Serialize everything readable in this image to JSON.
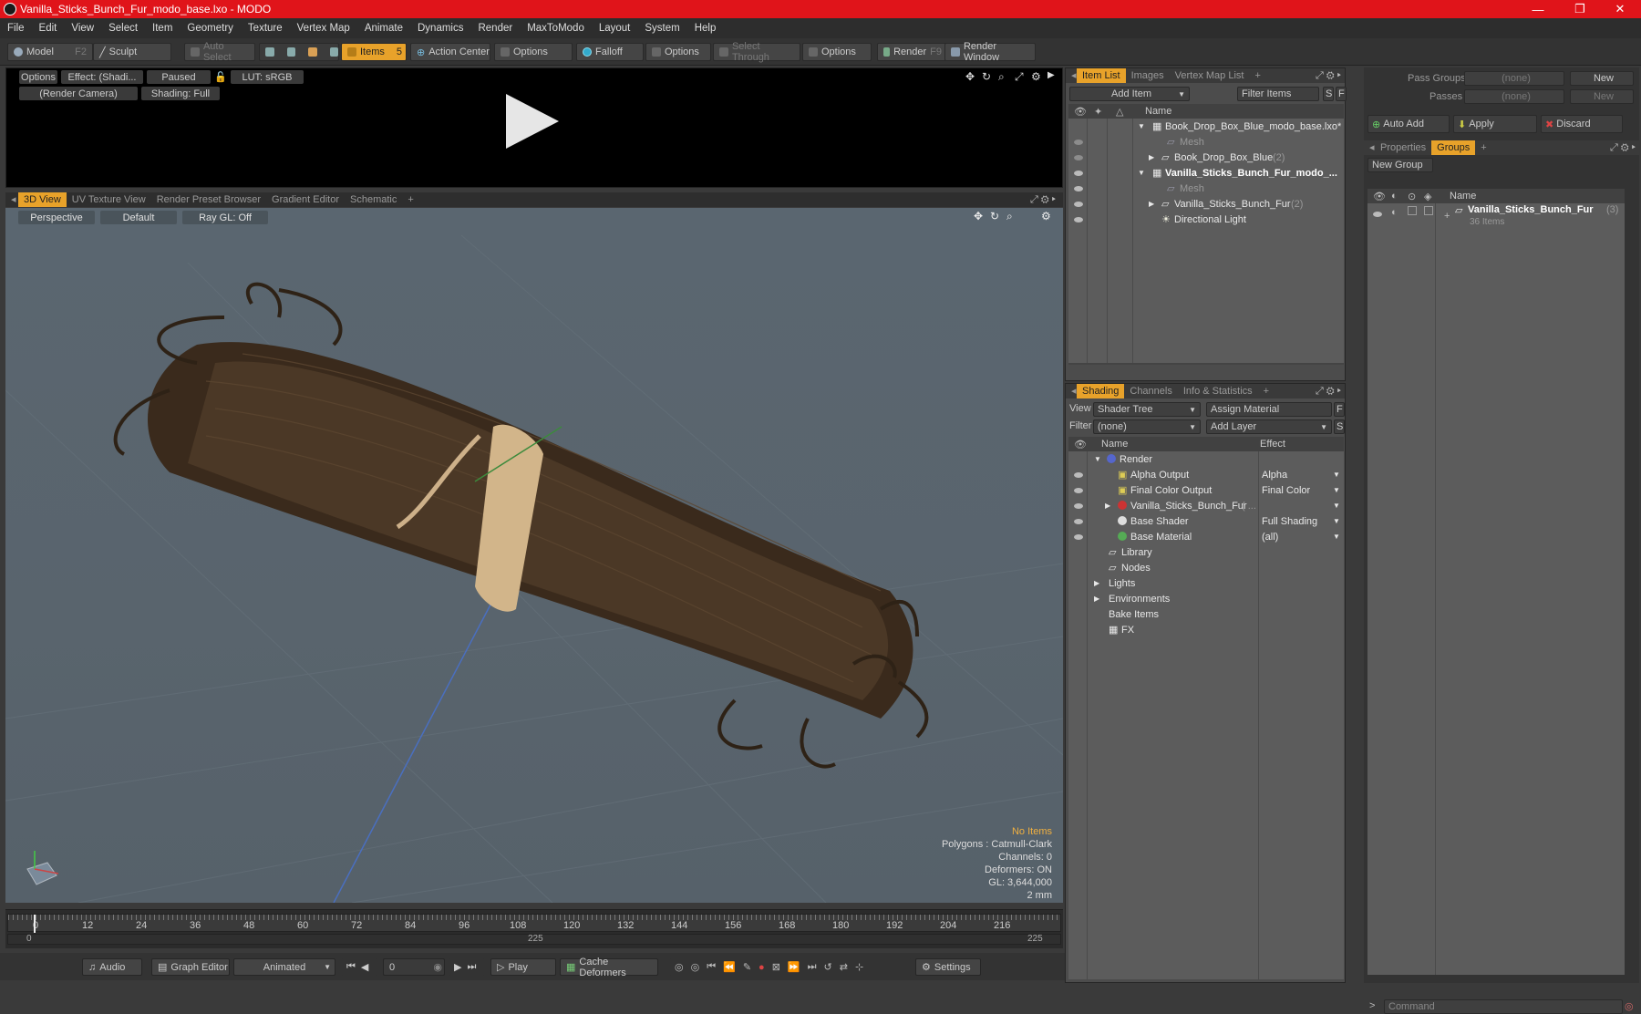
{
  "title": "Vanilla_Sticks_Bunch_Fur_modo_base.lxo - MODO",
  "window_controls": [
    "—",
    "❐",
    "✕"
  ],
  "menu": [
    "File",
    "Edit",
    "View",
    "Select",
    "Item",
    "Geometry",
    "Texture",
    "Vertex Map",
    "Animate",
    "Dynamics",
    "Render",
    "MaxToModo",
    "Layout",
    "System",
    "Help"
  ],
  "toolbar": {
    "model": "Model",
    "model_key": "F2",
    "sculpt": "Sculpt",
    "auto_select": "Auto Select",
    "items": "Items",
    "items_key": "5",
    "action_center": "Action Center",
    "options1": "Options",
    "falloff": "Falloff",
    "options2": "Options",
    "select_through": "Select Through",
    "options3": "Options",
    "render": "Render",
    "render_key": "F9",
    "render_window": "Render Window"
  },
  "render_view": {
    "options": "Options",
    "effect": "Effect: (Shadi...",
    "paused": "Paused",
    "lut": "LUT: sRGB",
    "camera": "(Render Camera)",
    "shading": "Shading: Full"
  },
  "viewport_tabs": [
    "3D View",
    "UV Texture View",
    "Render Preset Browser",
    "Gradient Editor",
    "Schematic",
    "+"
  ],
  "viewport": {
    "perspective": "Perspective",
    "default": "Default",
    "raygl": "Ray GL: Off",
    "info": {
      "no_items": "No Items",
      "polygons": "Polygons : Catmull-Clark",
      "channels": "Channels: 0",
      "deformers": "Deformers: ON",
      "gl": "GL: 3,644,000",
      "scale": "2 mm"
    }
  },
  "timeline": {
    "ticks": [
      "0",
      "12",
      "24",
      "36",
      "48",
      "60",
      "72",
      "84",
      "96",
      "108",
      "120",
      "132",
      "144",
      "156",
      "168",
      "180",
      "192",
      "204",
      "216"
    ],
    "start": "0",
    "mid": "225",
    "end": "225"
  },
  "bottombar": {
    "audio": "Audio",
    "graph_editor": "Graph Editor",
    "animated": "Animated",
    "frame": "0",
    "play": "Play",
    "cache_deformers": "Cache Deformers",
    "settings": "Settings"
  },
  "item_list": {
    "tabs": [
      "Item List",
      "Images",
      "Vertex Map List",
      "+"
    ],
    "add_item": "Add Item",
    "filter_items": "Filter Items",
    "s": "S",
    "f": "F",
    "col_name": "Name",
    "rows": [
      {
        "label": "Book_Drop_Box_Blue_modo_base.lxo*",
        "indent": 0,
        "bold": false,
        "dim": false
      },
      {
        "label": "Mesh",
        "indent": 1,
        "bold": false,
        "dim": true
      },
      {
        "label": "Book_Drop_Box_Blue",
        "suffix": "(2)",
        "indent": 1,
        "bold": false,
        "dim": false
      },
      {
        "label": "Vanilla_Sticks_Bunch_Fur_modo_...",
        "indent": 0,
        "bold": true,
        "dim": false
      },
      {
        "label": "Mesh",
        "indent": 1,
        "bold": false,
        "dim": true
      },
      {
        "label": "Vanilla_Sticks_Bunch_Fur",
        "suffix": "(2)",
        "indent": 1,
        "bold": false,
        "dim": false
      },
      {
        "label": "Directional Light",
        "indent": 1,
        "bold": false,
        "dim": false
      }
    ]
  },
  "shading": {
    "tabs": [
      "Shading",
      "Channels",
      "Info & Statistics",
      "+"
    ],
    "view_label": "View",
    "view_value": "Shader Tree",
    "assign_material": "Assign Material",
    "filter_label": "Filter",
    "filter_value": "(none)",
    "add_layer": "Add Layer",
    "f": "F",
    "s": "S",
    "col_name": "Name",
    "col_effect": "Effect",
    "rows": [
      {
        "label": "Render",
        "effect": ""
      },
      {
        "label": "Alpha Output",
        "effect": "Alpha"
      },
      {
        "label": "Final Color Output",
        "effect": "Final Color"
      },
      {
        "label": "Vanilla_Sticks_Bunch_Fur",
        "suffix": "( ...",
        "effect": ""
      },
      {
        "label": "Base Shader",
        "effect": "Full Shading"
      },
      {
        "label": "Base Material",
        "effect": "(all)"
      },
      {
        "label": "Library",
        "effect": ""
      },
      {
        "label": "Nodes",
        "effect": ""
      },
      {
        "label": "Lights",
        "effect": ""
      },
      {
        "label": "Environments",
        "effect": ""
      },
      {
        "label": "Bake Items",
        "effect": ""
      },
      {
        "label": "FX",
        "effect": ""
      }
    ]
  },
  "right_panel": {
    "pass_groups": "Pass Groups",
    "passes": "Passes",
    "none1": "(none)",
    "none2": "(none)",
    "new1": "New",
    "new2": "New",
    "auto_add": "Auto Add",
    "apply": "Apply",
    "discard": "Discard",
    "tabs": [
      "Properties",
      "Groups",
      "+"
    ],
    "new_group": "New Group",
    "col_name": "Name",
    "group_name": "Vanilla_Sticks_Bunch_Fur",
    "group_count": "(3)",
    "group_items": "36 Items",
    "command": "Command"
  }
}
